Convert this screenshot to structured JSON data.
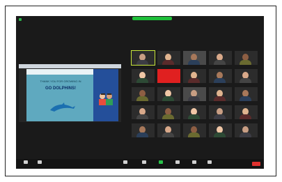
{
  "window": {
    "title": "",
    "recording_label": "",
    "meeting_id": "",
    "view_label": ""
  },
  "share": {
    "slide_line1": "THANK YOU FOR GROWING IN",
    "slide_line2": "GO DOLPHINS!"
  },
  "participants": [
    {
      "name": "",
      "active": true
    },
    {
      "name": ""
    },
    {
      "name": ""
    },
    {
      "name": ""
    },
    {
      "name": ""
    },
    {
      "name": ""
    },
    {
      "name": ""
    },
    {
      "name": ""
    },
    {
      "name": ""
    },
    {
      "name": ""
    },
    {
      "name": ""
    },
    {
      "name": ""
    },
    {
      "name": ""
    },
    {
      "name": ""
    },
    {
      "name": ""
    },
    {
      "name": ""
    },
    {
      "name": ""
    },
    {
      "name": ""
    },
    {
      "name": ""
    },
    {
      "name": ""
    },
    {
      "name": ""
    },
    {
      "name": ""
    },
    {
      "name": ""
    },
    {
      "name": ""
    },
    {
      "name": ""
    }
  ],
  "toolbar": {
    "mute": "",
    "video": "",
    "security": "",
    "participants": "",
    "chat": "",
    "share_screen": "",
    "record": "",
    "reactions": "",
    "end": ""
  },
  "colors": {
    "app_bg": "#1a1a1a",
    "accent_green": "#1fbf3a",
    "end_red": "#e0322f",
    "active_outline": "#c8e63a"
  }
}
